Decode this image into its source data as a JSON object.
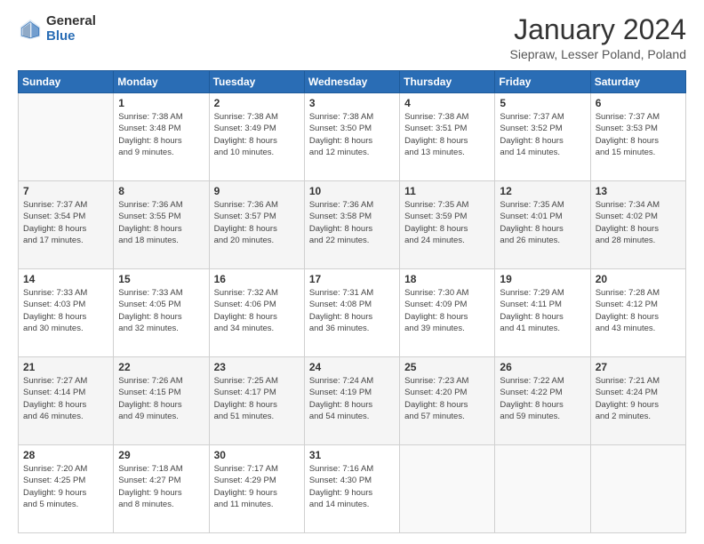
{
  "header": {
    "logo_general": "General",
    "logo_blue": "Blue",
    "title": "January 2024",
    "subtitle": "Siepraw, Lesser Poland, Poland"
  },
  "weekdays": [
    "Sunday",
    "Monday",
    "Tuesday",
    "Wednesday",
    "Thursday",
    "Friday",
    "Saturday"
  ],
  "weeks": [
    [
      {
        "day": "",
        "info": ""
      },
      {
        "day": "1",
        "info": "Sunrise: 7:38 AM\nSunset: 3:48 PM\nDaylight: 8 hours\nand 9 minutes."
      },
      {
        "day": "2",
        "info": "Sunrise: 7:38 AM\nSunset: 3:49 PM\nDaylight: 8 hours\nand 10 minutes."
      },
      {
        "day": "3",
        "info": "Sunrise: 7:38 AM\nSunset: 3:50 PM\nDaylight: 8 hours\nand 12 minutes."
      },
      {
        "day": "4",
        "info": "Sunrise: 7:38 AM\nSunset: 3:51 PM\nDaylight: 8 hours\nand 13 minutes."
      },
      {
        "day": "5",
        "info": "Sunrise: 7:37 AM\nSunset: 3:52 PM\nDaylight: 8 hours\nand 14 minutes."
      },
      {
        "day": "6",
        "info": "Sunrise: 7:37 AM\nSunset: 3:53 PM\nDaylight: 8 hours\nand 15 minutes."
      }
    ],
    [
      {
        "day": "7",
        "info": "Sunrise: 7:37 AM\nSunset: 3:54 PM\nDaylight: 8 hours\nand 17 minutes."
      },
      {
        "day": "8",
        "info": "Sunrise: 7:36 AM\nSunset: 3:55 PM\nDaylight: 8 hours\nand 18 minutes."
      },
      {
        "day": "9",
        "info": "Sunrise: 7:36 AM\nSunset: 3:57 PM\nDaylight: 8 hours\nand 20 minutes."
      },
      {
        "day": "10",
        "info": "Sunrise: 7:36 AM\nSunset: 3:58 PM\nDaylight: 8 hours\nand 22 minutes."
      },
      {
        "day": "11",
        "info": "Sunrise: 7:35 AM\nSunset: 3:59 PM\nDaylight: 8 hours\nand 24 minutes."
      },
      {
        "day": "12",
        "info": "Sunrise: 7:35 AM\nSunset: 4:01 PM\nDaylight: 8 hours\nand 26 minutes."
      },
      {
        "day": "13",
        "info": "Sunrise: 7:34 AM\nSunset: 4:02 PM\nDaylight: 8 hours\nand 28 minutes."
      }
    ],
    [
      {
        "day": "14",
        "info": "Sunrise: 7:33 AM\nSunset: 4:03 PM\nDaylight: 8 hours\nand 30 minutes."
      },
      {
        "day": "15",
        "info": "Sunrise: 7:33 AM\nSunset: 4:05 PM\nDaylight: 8 hours\nand 32 minutes."
      },
      {
        "day": "16",
        "info": "Sunrise: 7:32 AM\nSunset: 4:06 PM\nDaylight: 8 hours\nand 34 minutes."
      },
      {
        "day": "17",
        "info": "Sunrise: 7:31 AM\nSunset: 4:08 PM\nDaylight: 8 hours\nand 36 minutes."
      },
      {
        "day": "18",
        "info": "Sunrise: 7:30 AM\nSunset: 4:09 PM\nDaylight: 8 hours\nand 39 minutes."
      },
      {
        "day": "19",
        "info": "Sunrise: 7:29 AM\nSunset: 4:11 PM\nDaylight: 8 hours\nand 41 minutes."
      },
      {
        "day": "20",
        "info": "Sunrise: 7:28 AM\nSunset: 4:12 PM\nDaylight: 8 hours\nand 43 minutes."
      }
    ],
    [
      {
        "day": "21",
        "info": "Sunrise: 7:27 AM\nSunset: 4:14 PM\nDaylight: 8 hours\nand 46 minutes."
      },
      {
        "day": "22",
        "info": "Sunrise: 7:26 AM\nSunset: 4:15 PM\nDaylight: 8 hours\nand 49 minutes."
      },
      {
        "day": "23",
        "info": "Sunrise: 7:25 AM\nSunset: 4:17 PM\nDaylight: 8 hours\nand 51 minutes."
      },
      {
        "day": "24",
        "info": "Sunrise: 7:24 AM\nSunset: 4:19 PM\nDaylight: 8 hours\nand 54 minutes."
      },
      {
        "day": "25",
        "info": "Sunrise: 7:23 AM\nSunset: 4:20 PM\nDaylight: 8 hours\nand 57 minutes."
      },
      {
        "day": "26",
        "info": "Sunrise: 7:22 AM\nSunset: 4:22 PM\nDaylight: 8 hours\nand 59 minutes."
      },
      {
        "day": "27",
        "info": "Sunrise: 7:21 AM\nSunset: 4:24 PM\nDaylight: 9 hours\nand 2 minutes."
      }
    ],
    [
      {
        "day": "28",
        "info": "Sunrise: 7:20 AM\nSunset: 4:25 PM\nDaylight: 9 hours\nand 5 minutes."
      },
      {
        "day": "29",
        "info": "Sunrise: 7:18 AM\nSunset: 4:27 PM\nDaylight: 9 hours\nand 8 minutes."
      },
      {
        "day": "30",
        "info": "Sunrise: 7:17 AM\nSunset: 4:29 PM\nDaylight: 9 hours\nand 11 minutes."
      },
      {
        "day": "31",
        "info": "Sunrise: 7:16 AM\nSunset: 4:30 PM\nDaylight: 9 hours\nand 14 minutes."
      },
      {
        "day": "",
        "info": ""
      },
      {
        "day": "",
        "info": ""
      },
      {
        "day": "",
        "info": ""
      }
    ]
  ]
}
